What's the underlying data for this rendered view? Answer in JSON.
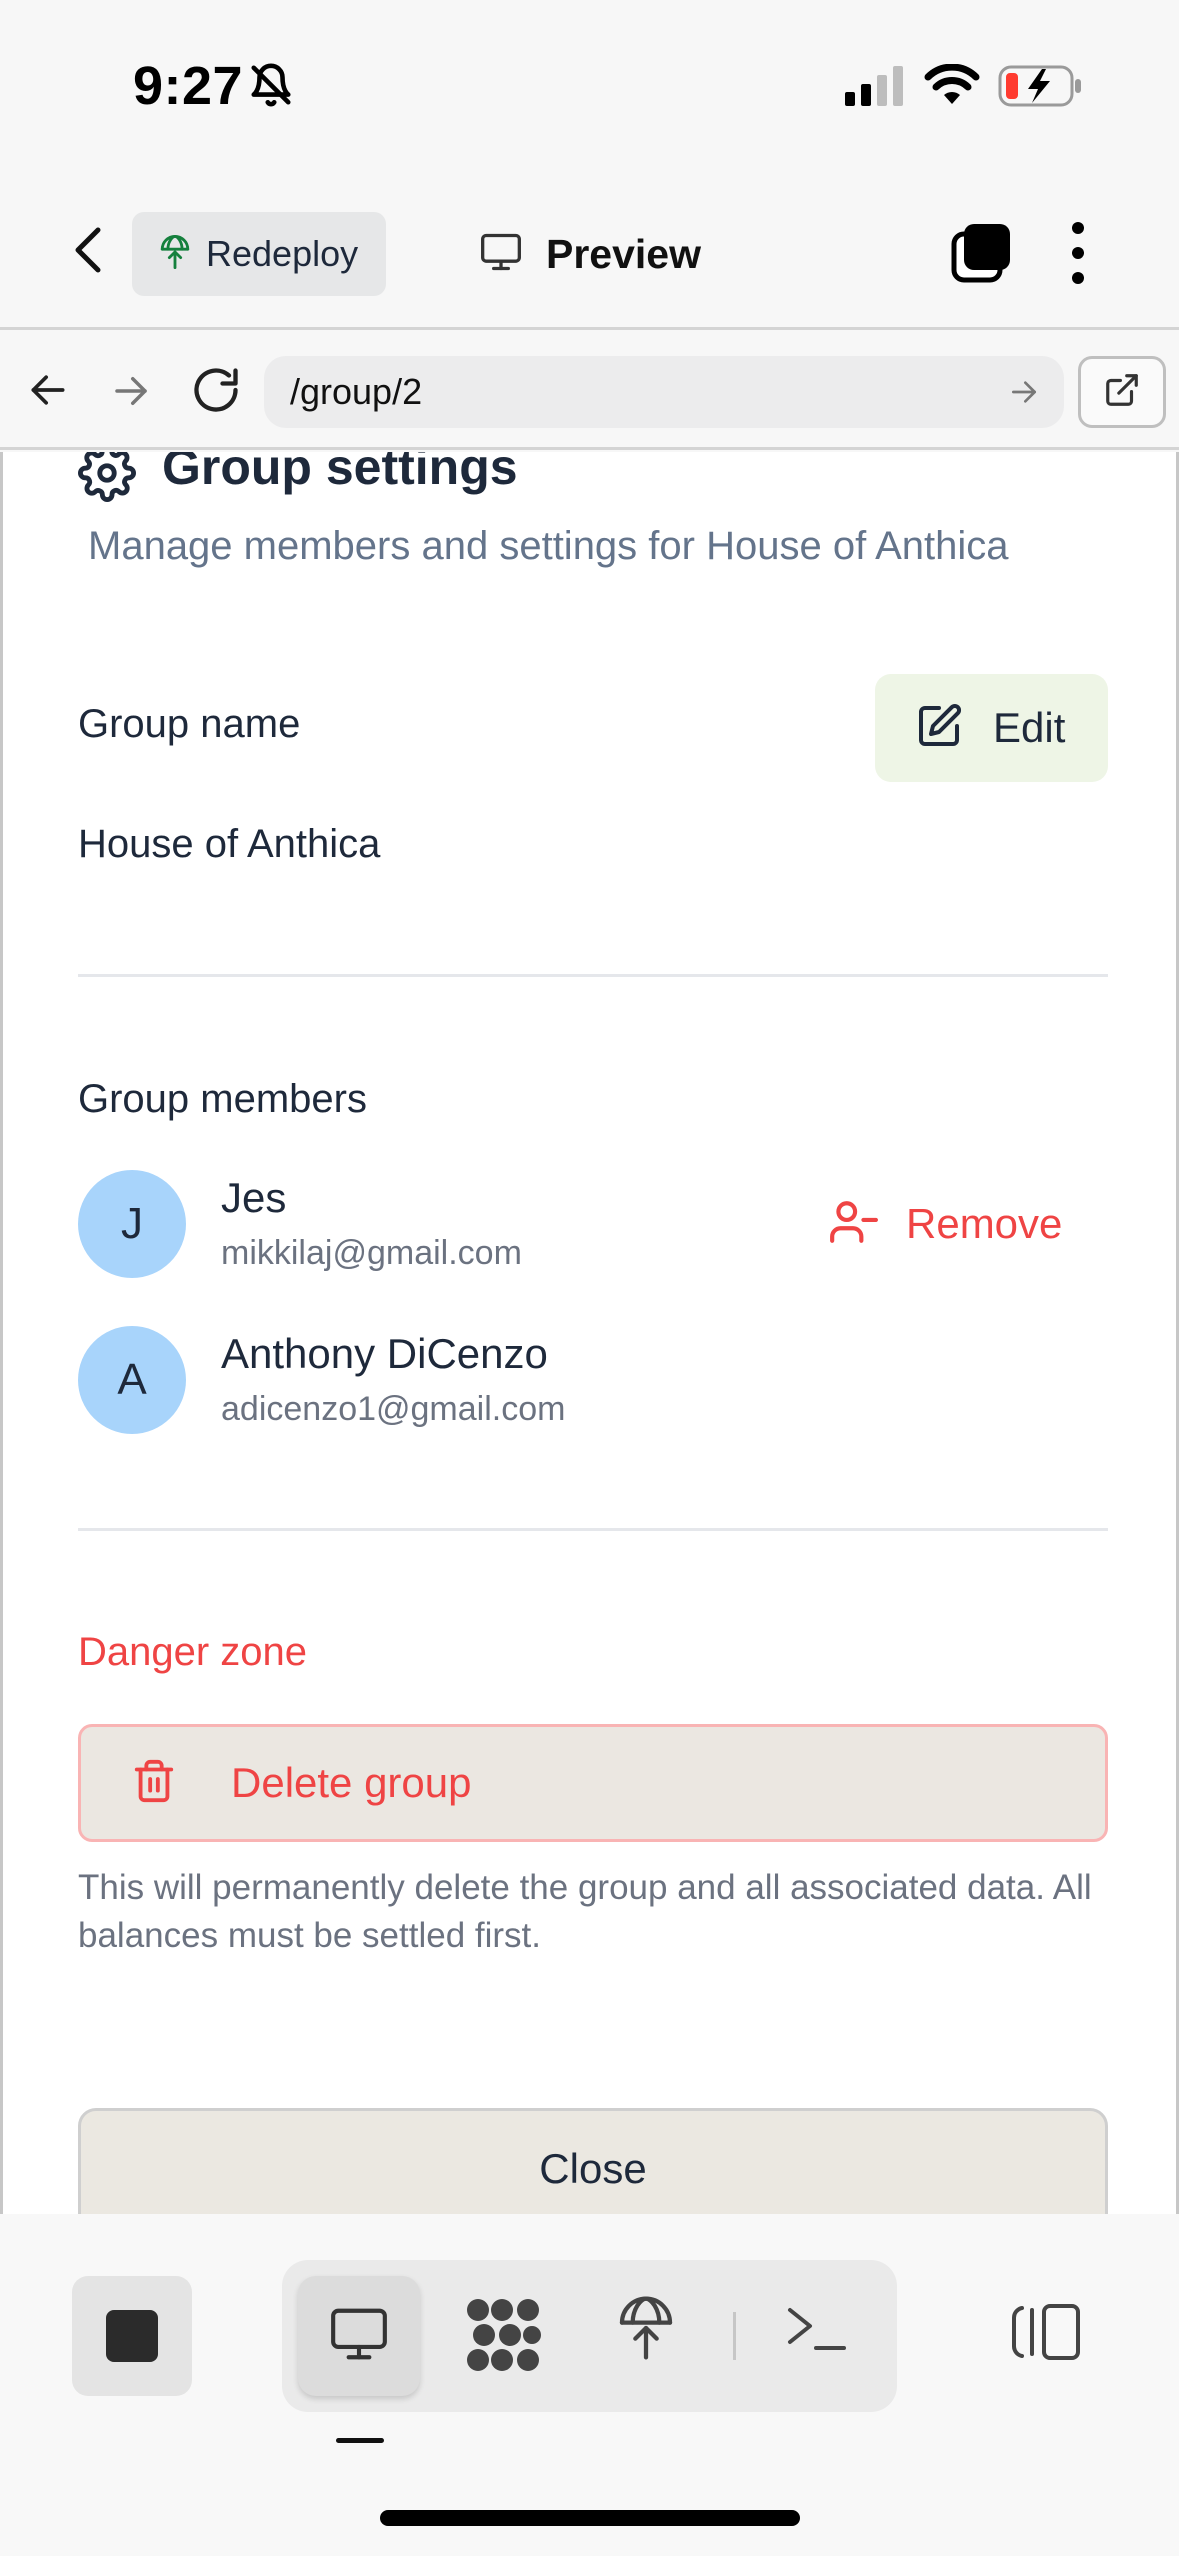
{
  "status_bar": {
    "time": "9:27",
    "icons": [
      "bell-slash-icon",
      "cellular-signal-icon",
      "wifi-icon",
      "battery-charging-icon"
    ]
  },
  "app_toolbar": {
    "redeploy_label": "Redeploy",
    "preview_label": "Preview"
  },
  "browser": {
    "url": "/group/2"
  },
  "page": {
    "title": "Group settings",
    "subtitle": "Manage members and settings for House of Anthica",
    "group_name_label": "Group name",
    "edit_label": "Edit",
    "group_name_value": "House of Anthica",
    "members_label": "Group members",
    "members": [
      {
        "initial": "J",
        "name": "Jes",
        "email": "mikkilaj@gmail.com",
        "action_label": "Remove"
      },
      {
        "initial": "A",
        "name": "Anthony DiCenzo",
        "email": "adicenzo1@gmail.com"
      }
    ],
    "danger_label": "Danger zone",
    "delete_label": "Delete group",
    "delete_note": "This will permanently delete the group and all associated data. All balances must be settled first.",
    "close_label": "Close"
  },
  "colors": {
    "danger": "#ef4444",
    "avatar": "#a8d4fb",
    "edit_bg": "#eef5e6",
    "text": "#1e293b",
    "muted": "#64748b"
  }
}
